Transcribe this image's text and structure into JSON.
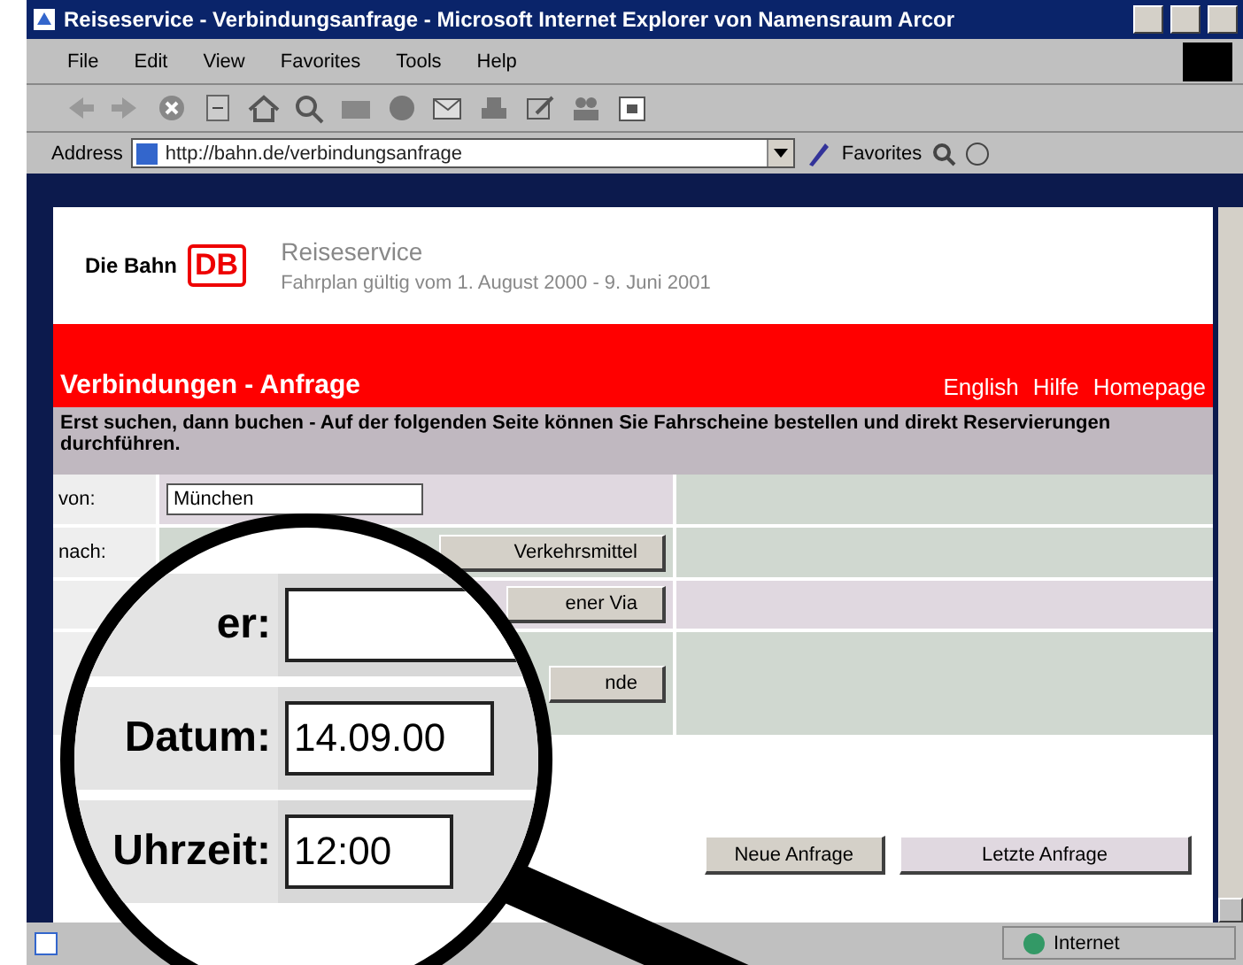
{
  "window": {
    "title": "Reiseservice - Verbindungsanfrage - Microsoft Internet Explorer von Namensraum Arcor"
  },
  "menu": [
    "File",
    "Edit",
    "View",
    "Favorites",
    "Tools",
    "Help"
  ],
  "address_bar": {
    "label": "Address",
    "url": "http://bahn.de/verbindungsanfrage",
    "links": "Favorites"
  },
  "page": {
    "brand": "Die Bahn",
    "logo": "DB",
    "service": "Reiseservice",
    "validity": "Fahrplan gültig vom 1. August 2000 - 9. Juni 2001",
    "heading": "Verbindungen - Anfrage",
    "links": [
      "English",
      "Hilfe",
      "Homepage"
    ],
    "intro": "Erst suchen, dann buchen - Auf der folgenden Seite können Sie Fahrscheine bestellen und direkt Reservierungen durchführen.",
    "rows": [
      {
        "label": "von:",
        "value": "München"
      },
      {
        "label": "nach:"
      }
    ],
    "side_buttons": [
      "Verkehrsmittel",
      "ener Via",
      "nde"
    ],
    "actions": [
      "Neue Anfrage",
      "Letzte Anfrage"
    ]
  },
  "magnifier": {
    "fields": [
      {
        "label": "er:"
      },
      {
        "label": "Datum:",
        "value": "14.09.00"
      },
      {
        "label": "Uhrzeit:",
        "value": "12:00"
      }
    ]
  },
  "status_bar": {
    "zone": "Internet"
  }
}
